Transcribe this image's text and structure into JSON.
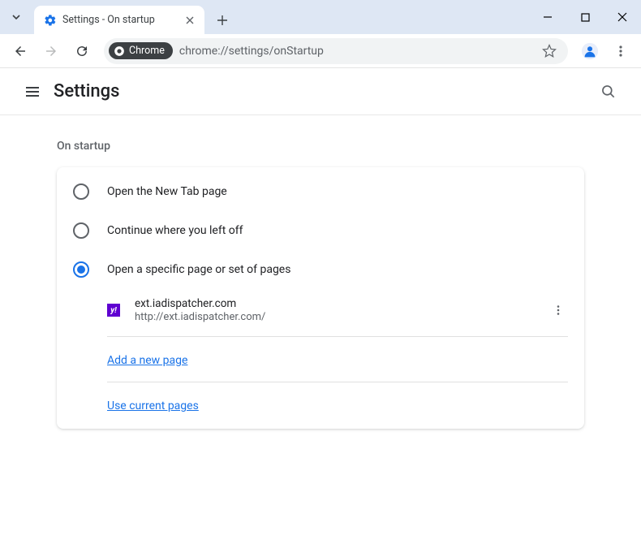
{
  "tab": {
    "title": "Settings - On startup"
  },
  "omnibox": {
    "chip": "Chrome",
    "url": "chrome://settings/onStartup"
  },
  "header": {
    "title": "Settings"
  },
  "section": {
    "title": "On startup",
    "options": {
      "newtab": "Open the New Tab page",
      "continue": "Continue where you left off",
      "specific": "Open a specific page or set of pages"
    },
    "page": {
      "title": "ext.iadispatcher.com",
      "url": "http://ext.iadispatcher.com/"
    },
    "add_link": "Add a new page",
    "use_current_link": "Use current pages"
  }
}
